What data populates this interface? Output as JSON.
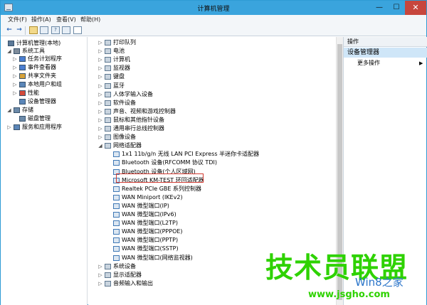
{
  "window": {
    "title": "计算机管理"
  },
  "titlebar": {
    "min": "—",
    "max": "☐",
    "close": "✕"
  },
  "menu": [
    "文件(F)",
    "操作(A)",
    "查看(V)",
    "帮助(H)"
  ],
  "toolbar": {
    "back": "←",
    "forward": "→",
    "help": "?"
  },
  "left_tree": [
    {
      "label": "计算机管理(本地)",
      "exp": ""
    },
    {
      "label": "系统工具",
      "exp": "◢"
    },
    {
      "label": "任务计划程序",
      "exp": "▷"
    },
    {
      "label": "事件查看器",
      "exp": "▷"
    },
    {
      "label": "共享文件夹",
      "exp": "▷"
    },
    {
      "label": "本地用户和组",
      "exp": "▷"
    },
    {
      "label": "性能",
      "exp": "▷"
    },
    {
      "label": "设备管理器",
      "exp": ""
    },
    {
      "label": "存储",
      "exp": "◢"
    },
    {
      "label": "磁盘管理",
      "exp": ""
    },
    {
      "label": "服务和应用程序",
      "exp": "▷"
    }
  ],
  "device_tree": [
    {
      "label": "打印队列",
      "exp": "▷"
    },
    {
      "label": "电池",
      "exp": "▷"
    },
    {
      "label": "计算机",
      "exp": "▷"
    },
    {
      "label": "监视器",
      "exp": "▷"
    },
    {
      "label": "键盘",
      "exp": "▷"
    },
    {
      "label": "蓝牙",
      "exp": "▷"
    },
    {
      "label": "人体学输入设备",
      "exp": "▷"
    },
    {
      "label": "软件设备",
      "exp": "▷"
    },
    {
      "label": "声音、视频和游戏控制器",
      "exp": "▷"
    },
    {
      "label": "鼠标和其他指针设备",
      "exp": "▷"
    },
    {
      "label": "通用串行总线控制器",
      "exp": "▷"
    },
    {
      "label": "图像设备",
      "exp": "▷"
    },
    {
      "label": "网络适配器",
      "exp": "◢"
    },
    {
      "label": "1x1 11b/g/n 无线 LAN PCI Express 半迷你卡适配器",
      "exp": ""
    },
    {
      "label": "Bluetooth 设备(RFCOMM 协议 TDI)",
      "exp": ""
    },
    {
      "label": "Bluetooth 设备(个人区域网)",
      "exp": ""
    },
    {
      "label": "Microsoft KM-TEST 环回适配器",
      "exp": ""
    },
    {
      "label": "Realtek PCIe GBE 系列控制器",
      "exp": ""
    },
    {
      "label": "WAN Miniport (IKEv2)",
      "exp": ""
    },
    {
      "label": "WAN 微型端口(IP)",
      "exp": ""
    },
    {
      "label": "WAN 微型端口(IPv6)",
      "exp": ""
    },
    {
      "label": "WAN 微型端口(L2TP)",
      "exp": ""
    },
    {
      "label": "WAN 微型端口(PPPOE)",
      "exp": ""
    },
    {
      "label": "WAN 微型端口(PPTP)",
      "exp": ""
    },
    {
      "label": "WAN 微型端口(SSTP)",
      "exp": ""
    },
    {
      "label": "WAN 微型端口(网络监视器)",
      "exp": ""
    },
    {
      "label": "系统设备",
      "exp": "▷"
    },
    {
      "label": "显示适配器",
      "exp": "▷"
    },
    {
      "label": "音频输入和输出",
      "exp": "▷"
    }
  ],
  "actions": {
    "header": "操作",
    "selected": "设备管理器",
    "more": "更多操作",
    "arrow": "▶"
  },
  "watermark": {
    "main": "技术员联盟",
    "sub": "Win8之家",
    "url": "www.jsgho.com"
  },
  "colors": {
    "titlebar": "#3aa4dd",
    "close": "#c7463d",
    "highlight_box": "#d23b32",
    "selection": "#cfe6f8",
    "watermark_green": "#2ed200",
    "watermark_blue": "#2a74c9"
  }
}
